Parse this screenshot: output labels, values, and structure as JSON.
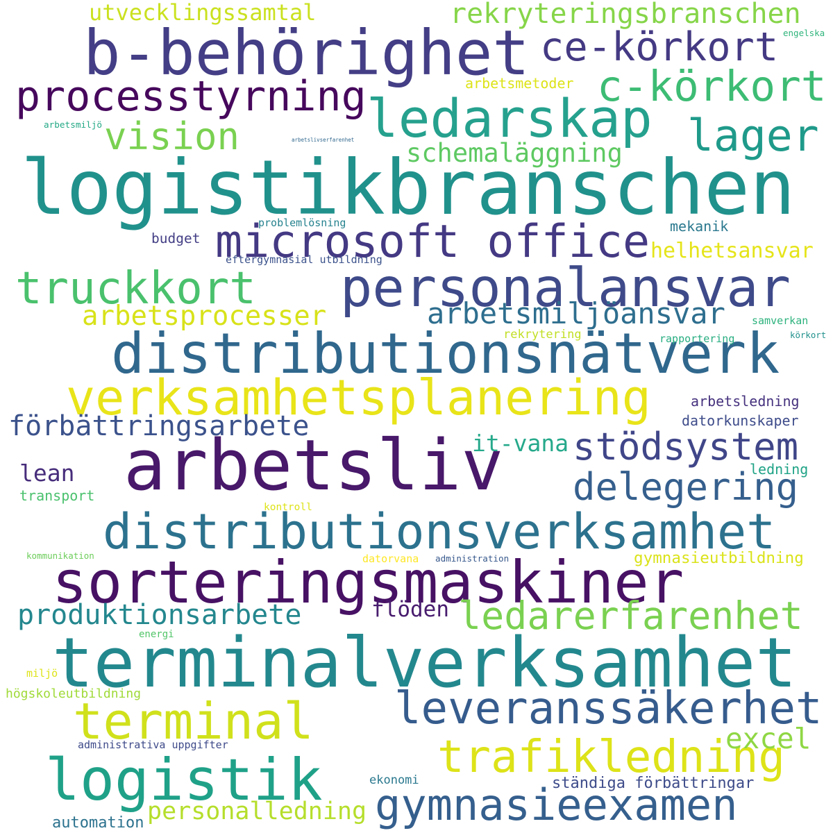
{
  "colors": {
    "background": "#ffffff",
    "palette": "viridis"
  },
  "words": {
    "logistikbranschen": "logistikbranschen",
    "b_behorighet": "b-behörighet",
    "arbetsliv": "arbetsliv",
    "terminalverksamhet": "terminalverksamhet",
    "sorteringsmaskiner": "sorteringsmaskiner",
    "distributionsnatverk": "distributionsnätverk",
    "distributionsverksamhet": "distributionsverksamhet",
    "verksamhetsplanering": "verksamhetsplanering",
    "personalansvar": "personalansvar",
    "microsoft_office": "microsoft office",
    "processtyrning": "processtyrning",
    "ledarskap": "ledarskap",
    "ce_korkort": "ce-körkort",
    "c_korkort": "c-körkort",
    "lager": "lager",
    "vision": "vision",
    "schemalaggning": "schemaläggning",
    "truckkort": "truckkort",
    "arbetsprocesser": "arbetsprocesser",
    "arbetsmiljoansvar": "arbetsmiljöansvar",
    "forbattringsarbete": "förbättringsarbete",
    "it_vana": "it-vana",
    "stodsystem": "stödsystem",
    "delegering": "delegering",
    "lean": "lean",
    "transport": "transport",
    "produktionsarbete": "produktionsarbete",
    "floden": "flöden",
    "ledarerfarenhet": "ledarerfarenhet",
    "terminal": "terminal",
    "leveranssakerhet": "leveranssäkerhet",
    "logistik": "logistik",
    "trafikledning": "trafikledning",
    "excel": "excel",
    "gymnasieexamen": "gymnasieexamen",
    "personalledning": "personalledning",
    "automation": "automation",
    "standiga_forbattringar": "ständiga förbättringar",
    "ekonomi": "ekonomi",
    "administrativa_uppgifter": "administrativa uppgifter",
    "hogskoleutbildning": "högskoleutbildning",
    "miljo": "miljö",
    "energi": "energi",
    "kommunikation": "kommunikation",
    "datorvana": "datorvana",
    "administration": "administration",
    "gymnasieutbildning": "gymnasieutbildning",
    "kontroll": "kontroll",
    "ledning": "ledning",
    "datorkunskaper": "datorkunskaper",
    "arbetsledning": "arbetsledning",
    "samverkan": "samverkan",
    "korkort": "körkort",
    "rapportering": "rapportering",
    "rekrytering": "rekrytering",
    "helhetsansvar": "helhetsansvar",
    "mekanik": "mekanik",
    "budget": "budget",
    "problemlosning": "problemlösning",
    "eftergymnasial_utbildning": "eftergymnasial utbildning",
    "arbetsmiljo": "arbetsmiljö",
    "arbetslivserfarenhet": "arbetslivserfarenhet",
    "utvecklingssamtal": "utvecklingssamtal",
    "rekryteringsbranschen": "rekryteringsbranschen",
    "arbetsmetoder": "arbetsmetoder",
    "engelska": "engelska"
  }
}
